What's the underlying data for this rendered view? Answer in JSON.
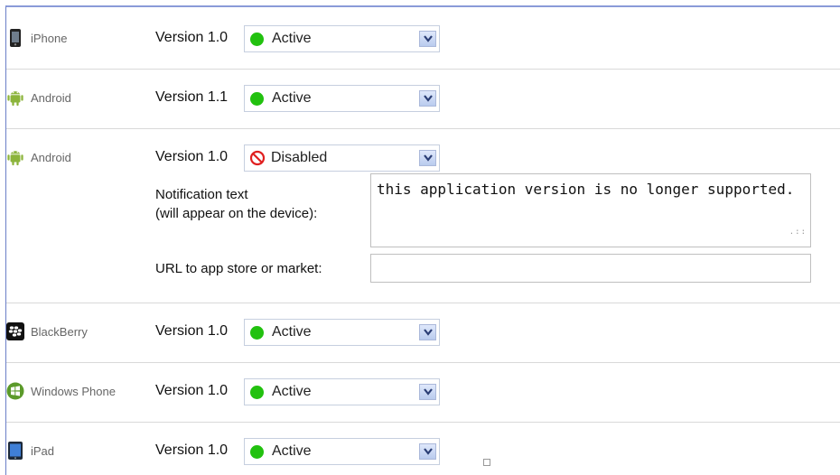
{
  "rows": [
    {
      "platform": "iPhone",
      "icon": "iphone-icon",
      "version": "Version 1.0",
      "status": "Active",
      "status_color": "#22c10f"
    },
    {
      "platform": "Android",
      "icon": "android-icon",
      "version": "Version 1.1",
      "status": "Active",
      "status_color": "#22c10f"
    },
    {
      "platform": "Android",
      "icon": "android-icon",
      "version": "Version 1.0",
      "status": "Disabled",
      "status_color": "#e02020",
      "notification_label_line1": "Notification text",
      "notification_label_line2": "(will appear on the device):",
      "notification_text": "this application version is no longer supported.",
      "url_label": "URL to app store or market:",
      "url_value": ""
    },
    {
      "platform": "BlackBerry",
      "icon": "blackberry-icon",
      "version": "Version 1.0",
      "status": "Active",
      "status_color": "#22c10f"
    },
    {
      "platform": "Windows Phone",
      "icon": "windows-phone-icon",
      "version": "Version 1.0",
      "status": "Active",
      "status_color": "#22c10f"
    },
    {
      "platform": "iPad",
      "icon": "ipad-icon",
      "version": "Version 1.0",
      "status": "Active",
      "status_color": "#22c10f"
    }
  ]
}
